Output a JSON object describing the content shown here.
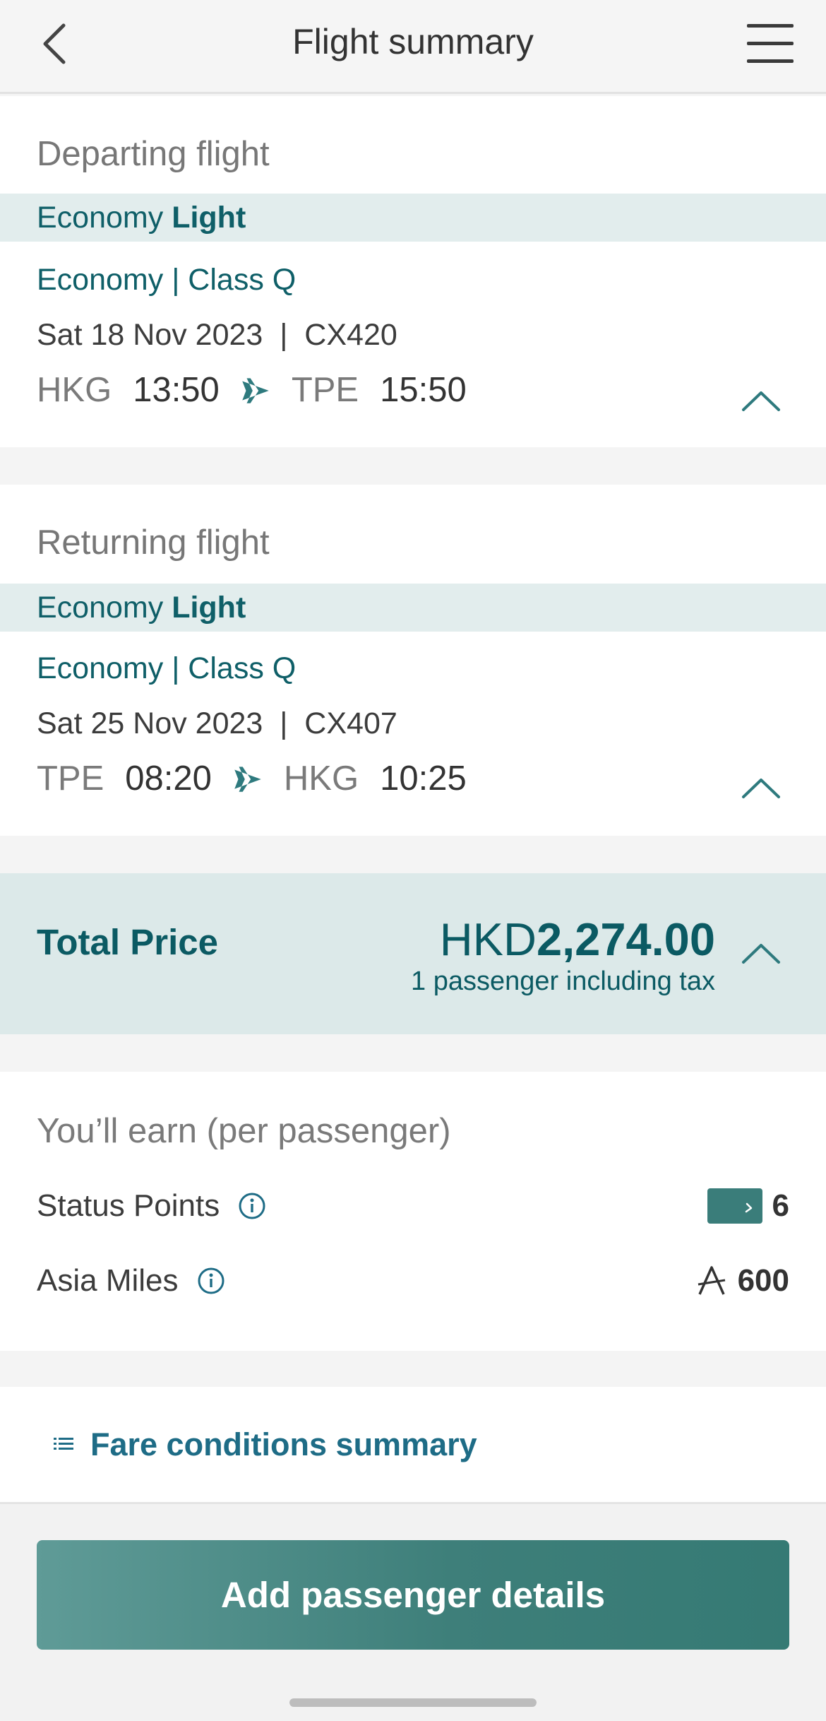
{
  "header": {
    "title": "Flight summary",
    "back_icon": "chevron-left-icon",
    "menu_icon": "hamburger-menu-icon"
  },
  "departing": {
    "section_title": "Departing flight",
    "fare_family_prefix": "Economy",
    "fare_family_name": "Light",
    "cabin_class": "Economy | Class Q",
    "date_flight": "Sat 18 Nov 2023  |  CX420",
    "origin": "HKG",
    "depart_time": "13:50",
    "destination": "TPE",
    "arrive_time": "15:50"
  },
  "returning": {
    "section_title": "Returning flight",
    "fare_family_prefix": "Economy",
    "fare_family_name": "Light",
    "cabin_class": "Economy | Class Q",
    "date_flight": "Sat 25 Nov 2023  |  CX407",
    "origin": "TPE",
    "depart_time": "08:20",
    "destination": "HKG",
    "arrive_time": "10:25"
  },
  "total": {
    "label": "Total Price",
    "currency": "HKD",
    "amount": "2,274.00",
    "subtext": "1 passenger including tax"
  },
  "earn": {
    "title": "You’ll earn (per passenger)",
    "status_points_label": "Status Points",
    "status_points_value": "6",
    "asia_miles_label": "Asia Miles",
    "asia_miles_value": "600"
  },
  "fare_conditions": {
    "label": "Fare conditions summary"
  },
  "cta": {
    "label": "Add passenger details"
  },
  "colors": {
    "brand_teal": "#0f5f68",
    "band_bg": "#e2eded",
    "total_bg": "#dce9e9",
    "cta": "#3e7f7a"
  }
}
